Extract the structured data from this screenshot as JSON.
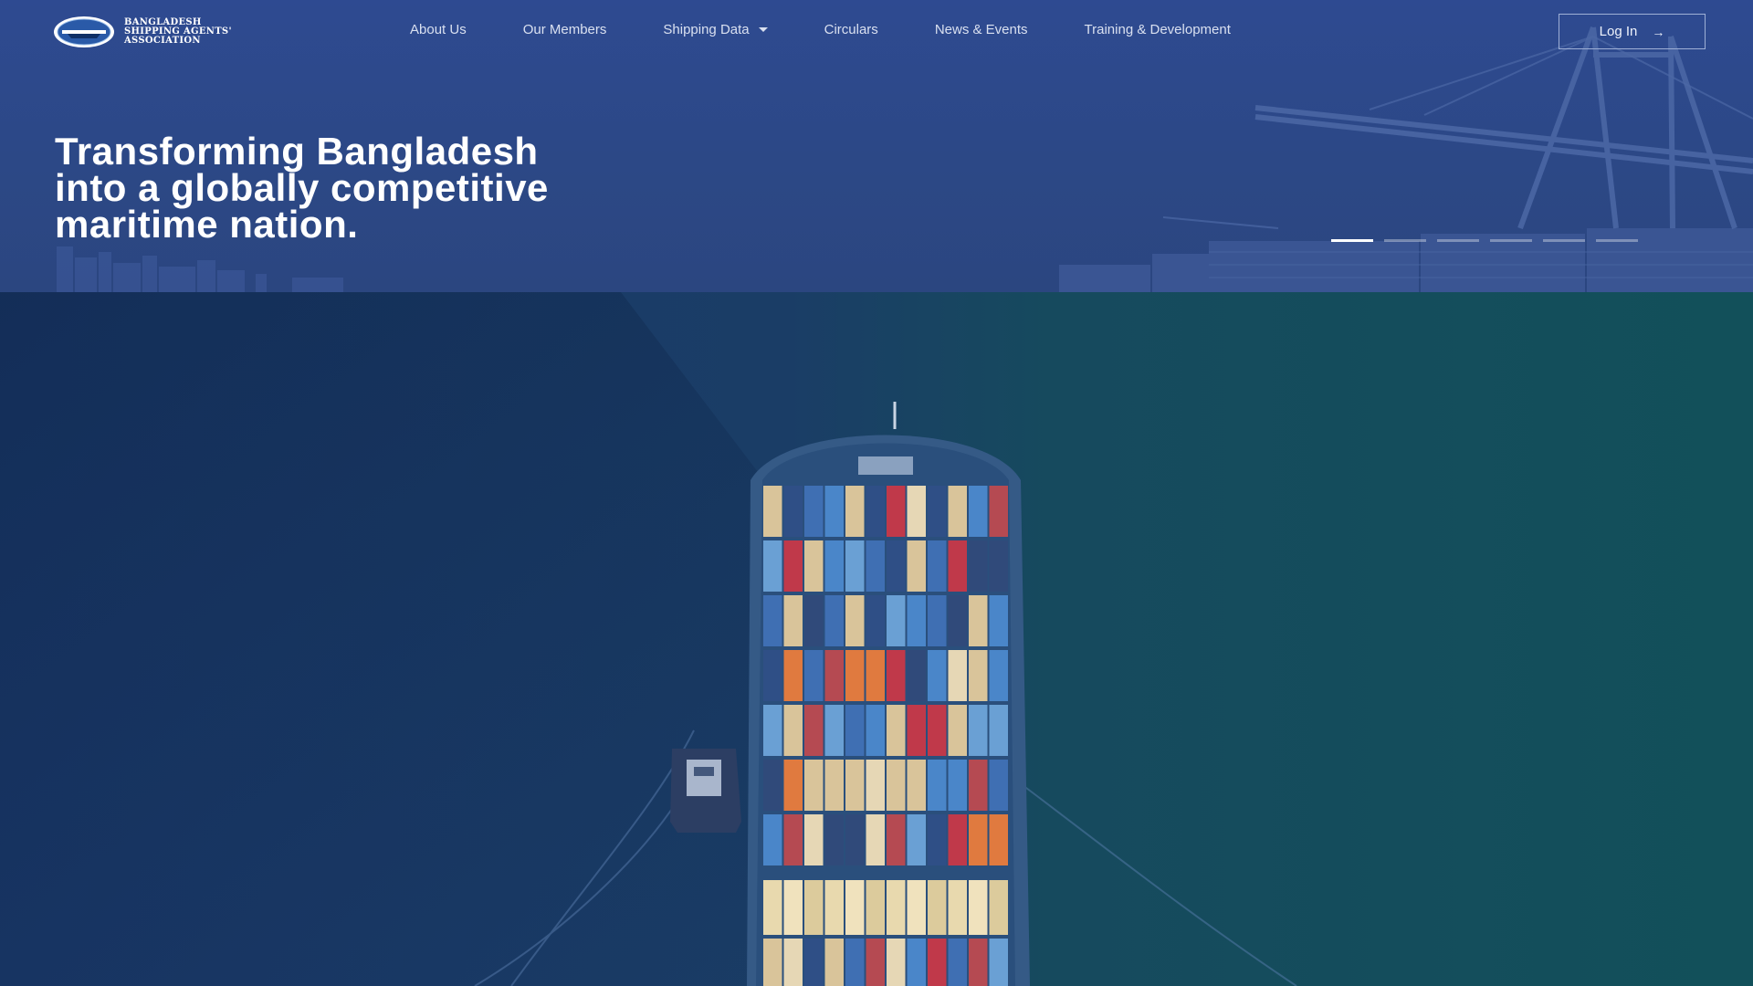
{
  "logo": {
    "lines": [
      "BANGLADESH",
      "SHIPPING AGENTS'",
      "ASSOCIATION"
    ],
    "icon": "bsaa-emblem-icon"
  },
  "nav": {
    "items": [
      {
        "label": "About Us"
      },
      {
        "label": "Our Members"
      },
      {
        "label": "Shipping Data",
        "dropdown": true
      },
      {
        "label": "Circulars"
      },
      {
        "label": "News & Events"
      },
      {
        "label": "Training & Development"
      }
    ],
    "login_label": "Log In",
    "login_icon": "arrow-right-icon"
  },
  "hero": {
    "headline_lines": [
      "Transforming Bangladesh",
      "into a globally competitive",
      "maritime nation."
    ],
    "slides_total": 6,
    "active_slide": 1
  },
  "colors": {
    "hero_overlay": "#2e4a91",
    "sea_dark": "#1c3b6b",
    "sea_teal": "#14505a",
    "text": "#ffffff",
    "nav_text": "#d9e0f0"
  }
}
